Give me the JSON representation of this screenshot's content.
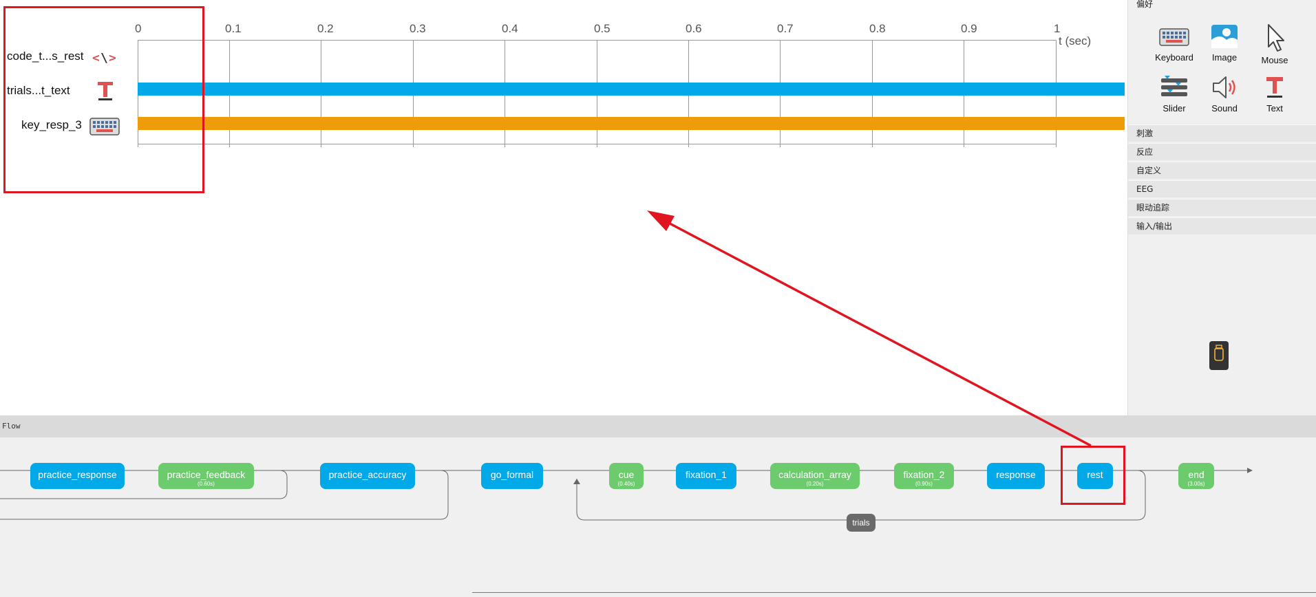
{
  "routine": {
    "time_ticks": [
      "0",
      "0.1",
      "0.2",
      "0.3",
      "0.4",
      "0.5",
      "0.6",
      "0.7",
      "0.8",
      "0.9",
      "1"
    ],
    "time_unit": "t (sec)",
    "components": [
      {
        "name": "code_t...s_rest",
        "icon": "code-icon",
        "bar_color": null
      },
      {
        "name": "trials...t_text",
        "icon": "text-icon",
        "bar_color": "#02a9e8"
      },
      {
        "name": "key_resp_3",
        "icon": "keyboard-icon",
        "bar_color": "#ef9c0a"
      }
    ]
  },
  "panel": {
    "favorites_label": "偏好",
    "favorites": [
      {
        "label": "Keyboard",
        "icon": "keyboard-icon"
      },
      {
        "label": "Image",
        "icon": "image-icon"
      },
      {
        "label": "Mouse",
        "icon": "mouse-icon"
      },
      {
        "label": "Slider",
        "icon": "slider-icon"
      },
      {
        "label": "Sound",
        "icon": "sound-icon"
      },
      {
        "label": "Text",
        "icon": "text-icon"
      }
    ],
    "categories": [
      "刺激",
      "反应",
      "自定义",
      "EEG",
      "眼动追踪",
      "输入/输出"
    ],
    "device_icon": "usb-device-icon"
  },
  "flow": {
    "label": "Flow",
    "routines": [
      {
        "name": "practice_response",
        "color": "blue",
        "duration": ""
      },
      {
        "name": "practice_feedback",
        "color": "green",
        "duration": "(0.60s)"
      },
      {
        "name": "practice_accuracy",
        "color": "blue",
        "duration": ""
      },
      {
        "name": "go_formal",
        "color": "blue",
        "duration": ""
      },
      {
        "name": "cue",
        "color": "green",
        "duration": "(0.40s)"
      },
      {
        "name": "fixation_1",
        "color": "blue",
        "duration": ""
      },
      {
        "name": "calculation_array",
        "color": "green",
        "duration": "(0.20s)"
      },
      {
        "name": "fixation_2",
        "color": "green",
        "duration": "(0.90s)"
      },
      {
        "name": "response",
        "color": "blue",
        "duration": ""
      },
      {
        "name": "rest",
        "color": "blue",
        "duration": ""
      },
      {
        "name": "end",
        "color": "green",
        "duration": "(3.00s)"
      }
    ],
    "loop_label": "trials"
  },
  "annotations": {
    "highlight_color": "#e0151f"
  }
}
